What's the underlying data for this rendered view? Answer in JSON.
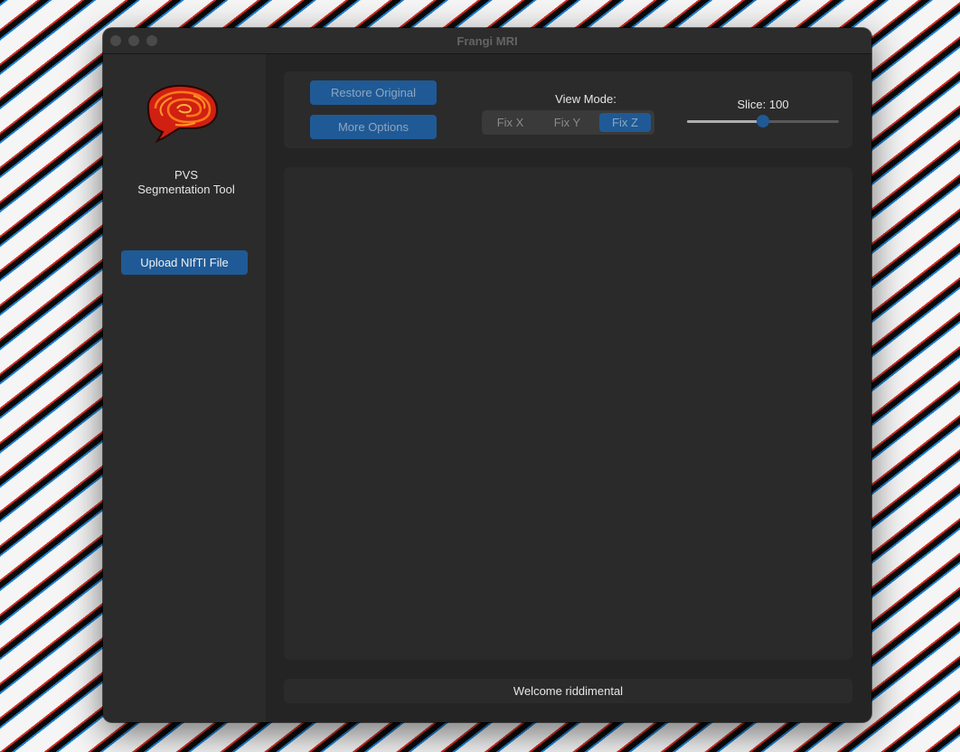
{
  "window": {
    "title": "Frangi MRI"
  },
  "sidebar": {
    "logo_icon": "brain-icon",
    "tool_name_line1": "PVS",
    "tool_name_line2": "Segmentation Tool",
    "upload_label": "Upload NIfTI File"
  },
  "toolbar": {
    "restore_label": "Restore Original",
    "more_options_label": "More Options",
    "view_mode_label": "View Mode:",
    "view_modes": [
      {
        "label": "Fix X",
        "selected": false
      },
      {
        "label": "Fix Y",
        "selected": false
      },
      {
        "label": "Fix Z",
        "selected": true
      }
    ],
    "slice_label": "Slice: 100",
    "slice_value_fraction": 0.5
  },
  "status": {
    "message": "Welcome riddimental"
  },
  "colors": {
    "accent": "#1f5a96",
    "window_bg": "#242424",
    "panel_bg": "#2b2b2b",
    "text": "#e6e6e6"
  }
}
